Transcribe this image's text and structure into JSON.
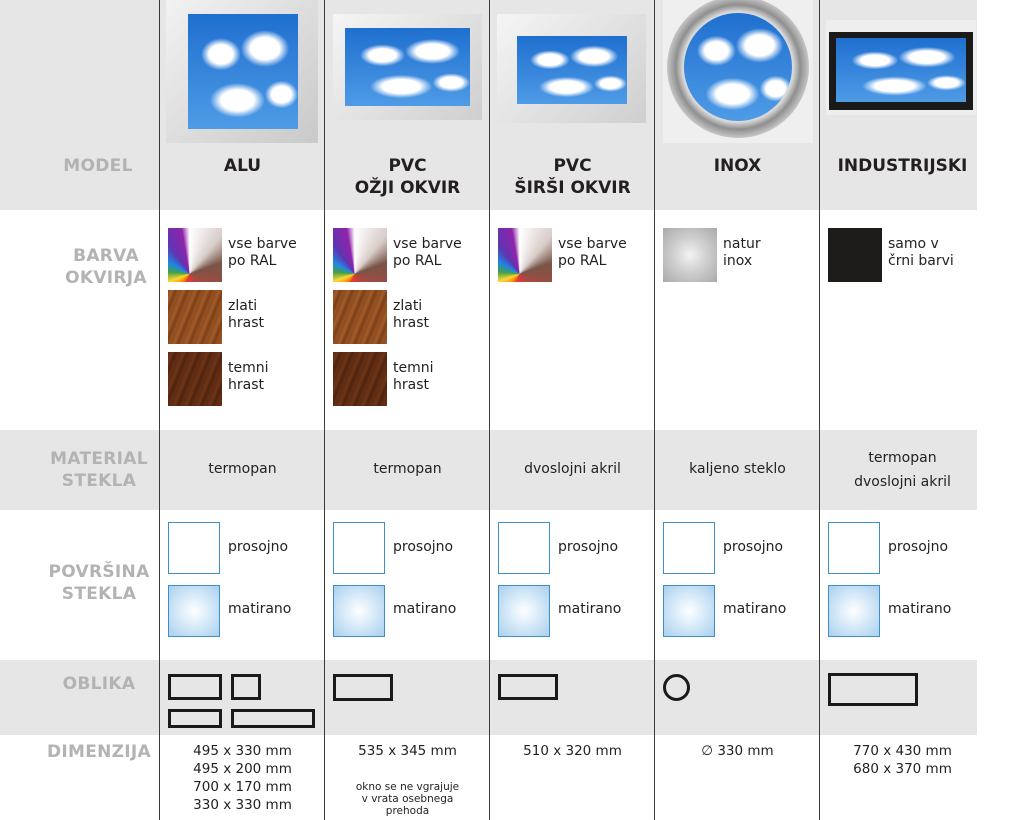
{
  "row_labels": {
    "model": "MODEL",
    "barva_1": "BARVA",
    "barva_2": "OKVIRJA",
    "material_1": "MATERIAL",
    "material_2": "STEKLA",
    "povrsina_1": "POVRŠINA",
    "povrsina_2": "STEKLA",
    "oblika": "OBLIKA",
    "dimenzija": "DIMENZIJA"
  },
  "models": [
    {
      "name_1": "ALU",
      "name_2": "",
      "colors": [
        {
          "swatch": "ral-color-fan",
          "label_1": "vse barve",
          "label_2": "po RAL"
        },
        {
          "swatch": "golden-oak-wood",
          "label_1": "zlati",
          "label_2": "hrast"
        },
        {
          "swatch": "dark-oak-wood",
          "label_1": "temni",
          "label_2": "hrast"
        }
      ],
      "material_1": "termopan",
      "material_2": "",
      "surface": {
        "clear": "prosojno",
        "frosted": "matirano"
      },
      "dims": [
        "495 x 330 mm",
        "495 x 200 mm",
        "700 x 170 mm",
        "330 x 330 mm"
      ],
      "note": []
    },
    {
      "name_1": "PVC",
      "name_2": "OŽJI OKVIR",
      "colors": [
        {
          "swatch": "ral-color-fan",
          "label_1": "vse barve",
          "label_2": "po RAL"
        },
        {
          "swatch": "golden-oak-wood",
          "label_1": "zlati",
          "label_2": "hrast"
        },
        {
          "swatch": "dark-oak-wood",
          "label_1": "temni",
          "label_2": "hrast"
        }
      ],
      "material_1": "termopan",
      "material_2": "",
      "surface": {
        "clear": "prosojno",
        "frosted": "matirano"
      },
      "dims": [
        "535 x 345 mm"
      ],
      "note": [
        "okno se ne vgrajuje",
        "v vrata osebnega",
        "prehoda"
      ]
    },
    {
      "name_1": "PVC",
      "name_2": "ŠIRŠI OKVIR",
      "colors": [
        {
          "swatch": "ral-color-fan",
          "label_1": "vse barve",
          "label_2": "po RAL"
        }
      ],
      "material_1": "dvoslojni akril",
      "material_2": "",
      "surface": {
        "clear": "prosojno",
        "frosted": "matirano"
      },
      "dims": [
        "510 x 320 mm"
      ],
      "note": []
    },
    {
      "name_1": "INOX",
      "name_2": "",
      "colors": [
        {
          "swatch": "brushed-inox",
          "label_1": "natur",
          "label_2": "inox"
        }
      ],
      "material_1": "kaljeno steklo",
      "material_2": "",
      "surface": {
        "clear": "prosojno",
        "frosted": "matirano"
      },
      "dims": [
        "∅ 330 mm"
      ],
      "note": []
    },
    {
      "name_1": "INDUSTRIJSKI",
      "name_2": "",
      "colors": [
        {
          "swatch": "black",
          "label_1": "samo v",
          "label_2": "črni barvi"
        }
      ],
      "material_1": "termopan",
      "material_2": "dvoslojni akril",
      "surface": {
        "clear": "prosojno",
        "frosted": "matirano"
      },
      "dims": [
        "770 x 430 mm",
        "680 x 370 mm"
      ],
      "note": []
    }
  ],
  "colors": {
    "row_shade": "#e6e6e7",
    "label_gray": "#b3b3b3",
    "glass_border": "#3e8ec8",
    "shape_outline": "#1a1a1a"
  }
}
